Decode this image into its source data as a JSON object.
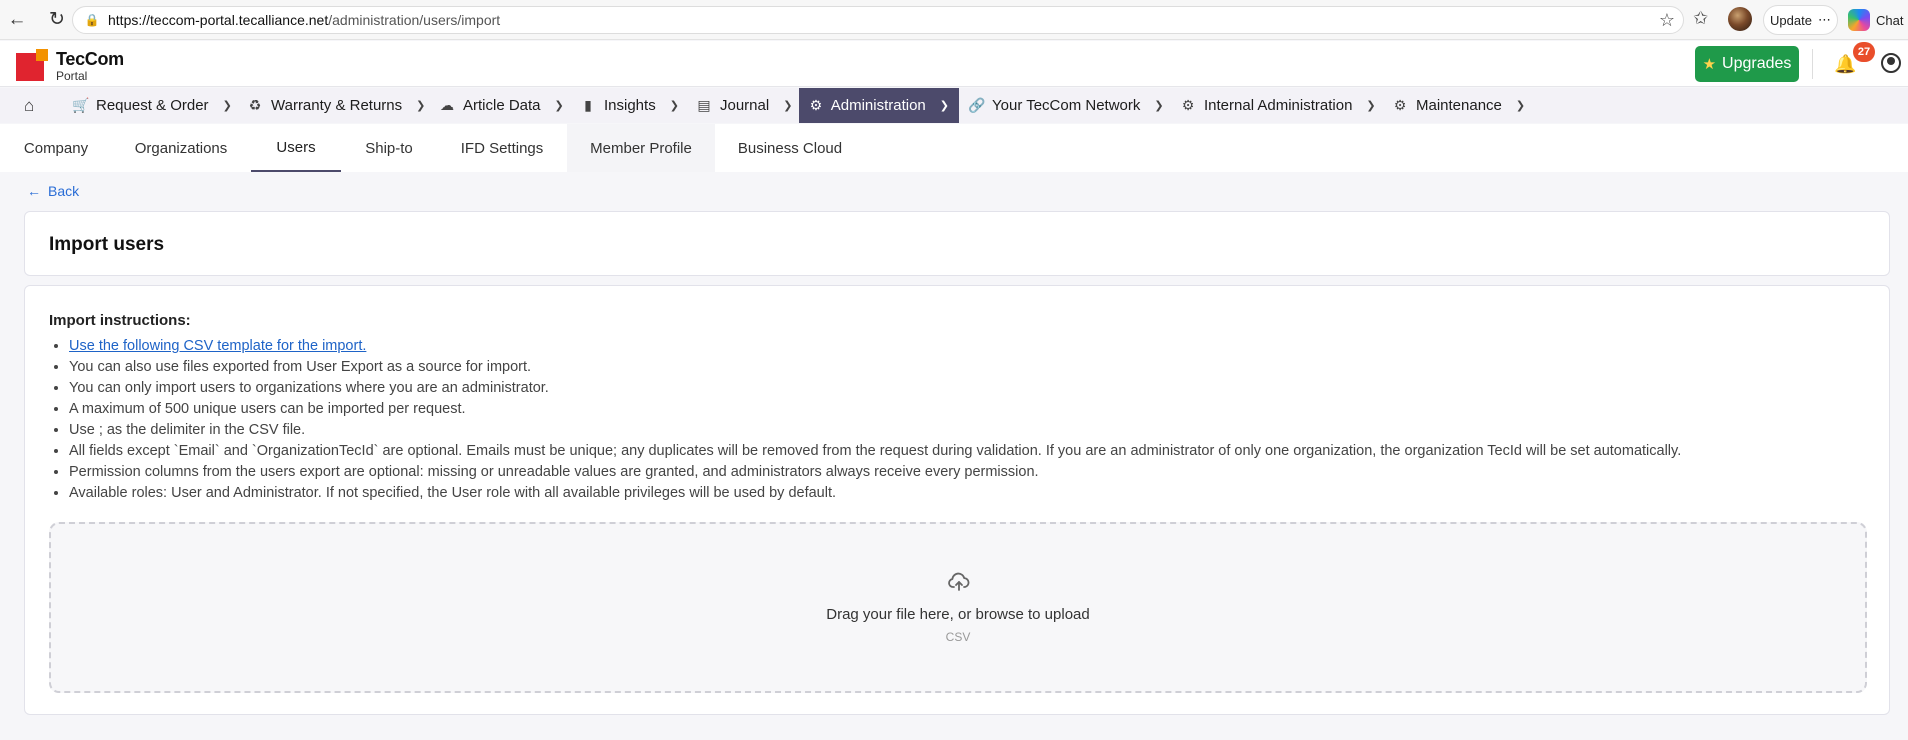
{
  "browser": {
    "url_host": "https://teccom-portal.tecalliance.net",
    "url_path": "/administration/users/import",
    "update_label": "Update",
    "chat_label": "Chat"
  },
  "header": {
    "brand_name": "TecCom",
    "brand_sub": "Portal",
    "upgrades_label": "Upgrades",
    "notification_count": "27",
    "colors": {
      "upgrades": "#1f9a4a",
      "badge": "#e94e2b",
      "logo_red": "#e0242f",
      "logo_orange": "#f39200"
    }
  },
  "main_nav": {
    "items": [
      {
        "label": "Request & Order",
        "icon": "cart-icon"
      },
      {
        "label": "Warranty & Returns",
        "icon": "recycle-icon"
      },
      {
        "label": "Article Data",
        "icon": "cloud-icon"
      },
      {
        "label": "Insights",
        "icon": "chart-icon"
      },
      {
        "label": "Journal",
        "icon": "journal-icon"
      },
      {
        "label": "Administration",
        "icon": "gear-icon",
        "active": true
      },
      {
        "label": "Your TecCom Network",
        "icon": "link-icon"
      },
      {
        "label": "Internal Administration",
        "icon": "gears-icon"
      },
      {
        "label": "Maintenance",
        "icon": "gears-icon"
      }
    ],
    "active_color": "#4c4a6b"
  },
  "subtabs": {
    "items": [
      {
        "label": "Company"
      },
      {
        "label": "Organizations"
      },
      {
        "label": "Users",
        "active": true
      },
      {
        "label": "Ship-to"
      },
      {
        "label": "IFD Settings"
      },
      {
        "label": "Member Profile"
      },
      {
        "label": "Business Cloud"
      }
    ]
  },
  "back_label": "Back",
  "page_title": "Import users",
  "instructions": {
    "title": "Import instructions:",
    "items": [
      "Use the following CSV template for the import.",
      "You can also use files exported from User Export as a source for import.",
      "You can only import users to organizations where you are an administrator.",
      "A maximum of 500 unique users can be imported per request.",
      "Use ; as the delimiter in the CSV file.",
      "All fields except `Email` and `OrganizationTecId` are optional. Emails must be unique; any duplicates will be removed from the request during validation. If you are an administrator of only one organization, the organization TecId will be set automatically.",
      "Permission columns from the users export are optional: missing or unreadable values are granted, and administrators always receive every permission.",
      "Available roles: User and Administrator. If not specified, the User role with all available privileges will be used by default."
    ]
  },
  "dropzone": {
    "text": "Drag your file here, or browse to upload",
    "sub": "CSV"
  }
}
